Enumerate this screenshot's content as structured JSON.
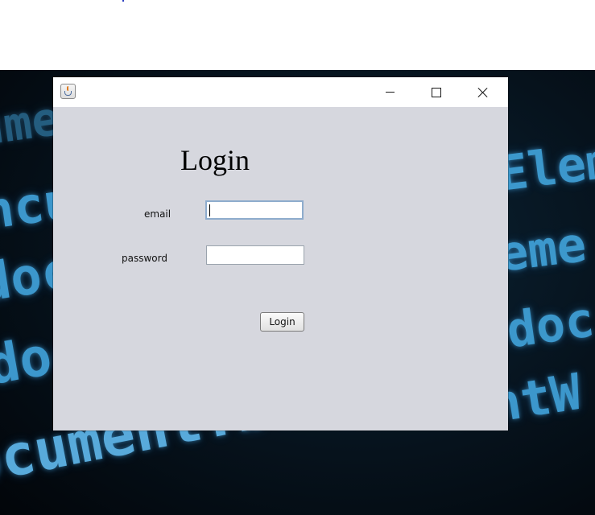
{
  "window": {
    "controls": {
      "minimize_icon": "minimize-icon",
      "maximize_icon": "maximize-icon",
      "close_icon": "close-icon"
    },
    "app_icon": "java-icon"
  },
  "form": {
    "heading": "Login",
    "email_label": "email",
    "email_value": "",
    "password_label": "password",
    "password_value": "",
    "login_button_label": "Login"
  },
  "background": {
    "code_lines": [
      "ume",
      "ncument",
      "docume",
      "docume",
      "ocument.body.cli",
      "Elem",
      "eme",
      "doc",
      "ntW"
    ]
  },
  "colors": {
    "window_bg": "#d6d7de",
    "titlebar_bg": "#ffffff",
    "focus_border": "#8eaccd",
    "code_glow": "#3f9fd6"
  }
}
